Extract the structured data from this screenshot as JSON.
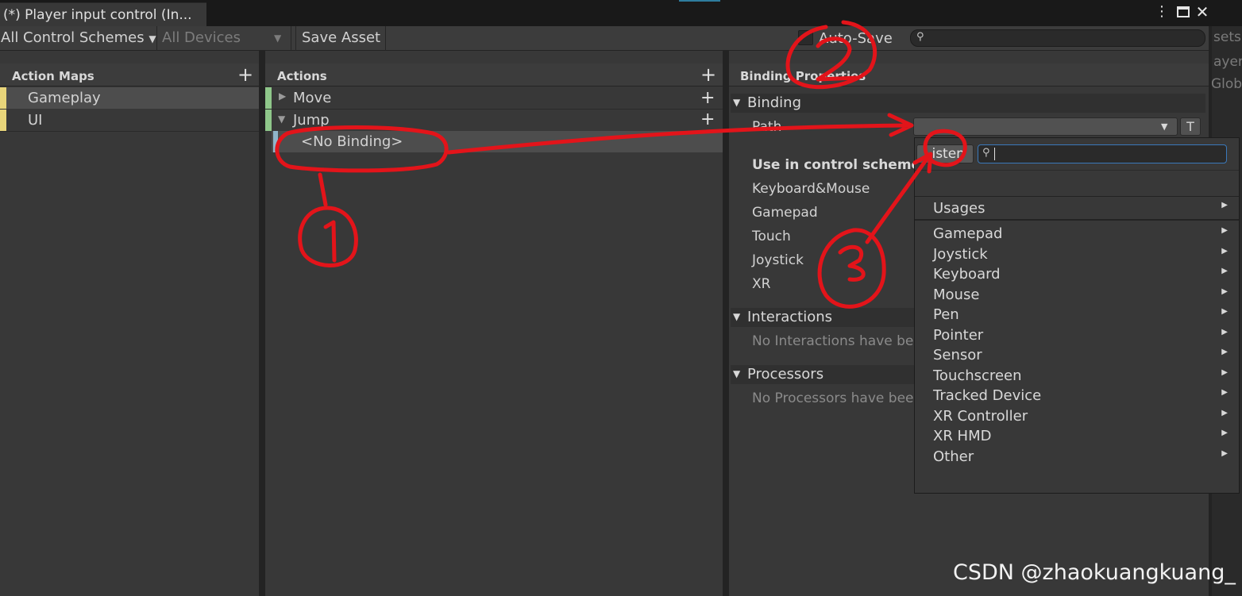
{
  "window": {
    "tab_title": "(*) Player input control (In...",
    "menu_icon": "kebab-menu-icon",
    "maximize_icon": "maximize-icon",
    "close_icon": "close-icon"
  },
  "toolbar": {
    "control_schemes": "All Control Schemes",
    "devices": "All Devices",
    "save_asset": "Save Asset",
    "auto_save": "Auto-Save",
    "search_placeholder": ""
  },
  "background_fragments": [
    "sets",
    "ayer",
    "Globa"
  ],
  "action_maps": {
    "header": "Action Maps",
    "items": [
      {
        "label": "Gameplay",
        "selected": true
      },
      {
        "label": "UI",
        "selected": false
      }
    ]
  },
  "actions": {
    "header": "Actions",
    "items": [
      {
        "label": "Move",
        "expanded": false
      },
      {
        "label": "Jump",
        "expanded": true
      }
    ],
    "binding": "<No Binding>"
  },
  "binding_properties": {
    "header": "Binding Properties",
    "binding_section": "Binding",
    "path_label": "Path",
    "t_button": "T",
    "use_in_schemes": "Use in control scheme",
    "schemes": [
      "Keyboard&Mouse",
      "Gamepad",
      "Touch",
      "Joystick",
      "XR"
    ],
    "interactions": "Interactions",
    "no_interactions": "No Interactions have be",
    "processors": "Processors",
    "no_processors": "No Processors have bee"
  },
  "popup": {
    "listen": "Listen",
    "search_value": "",
    "usages": "Usages",
    "devices": [
      "Gamepad",
      "Joystick",
      "Keyboard",
      "Mouse",
      "Pen",
      "Pointer",
      "Sensor",
      "Touchscreen",
      "Tracked Device",
      "XR Controller",
      "XR HMD",
      "Other"
    ]
  },
  "annotations": {
    "color": "#e3141a",
    "marks": [
      "1",
      "2",
      "3"
    ]
  },
  "watermark": "CSDN @zhaokuangkuang_",
  "colors": {
    "gameplay_marker": "#e8d57a",
    "action_marker": "#8fc78a",
    "binding_marker": "#8fb5c9",
    "selection": "#4d4d4d",
    "focus_border": "#3a79bb"
  }
}
